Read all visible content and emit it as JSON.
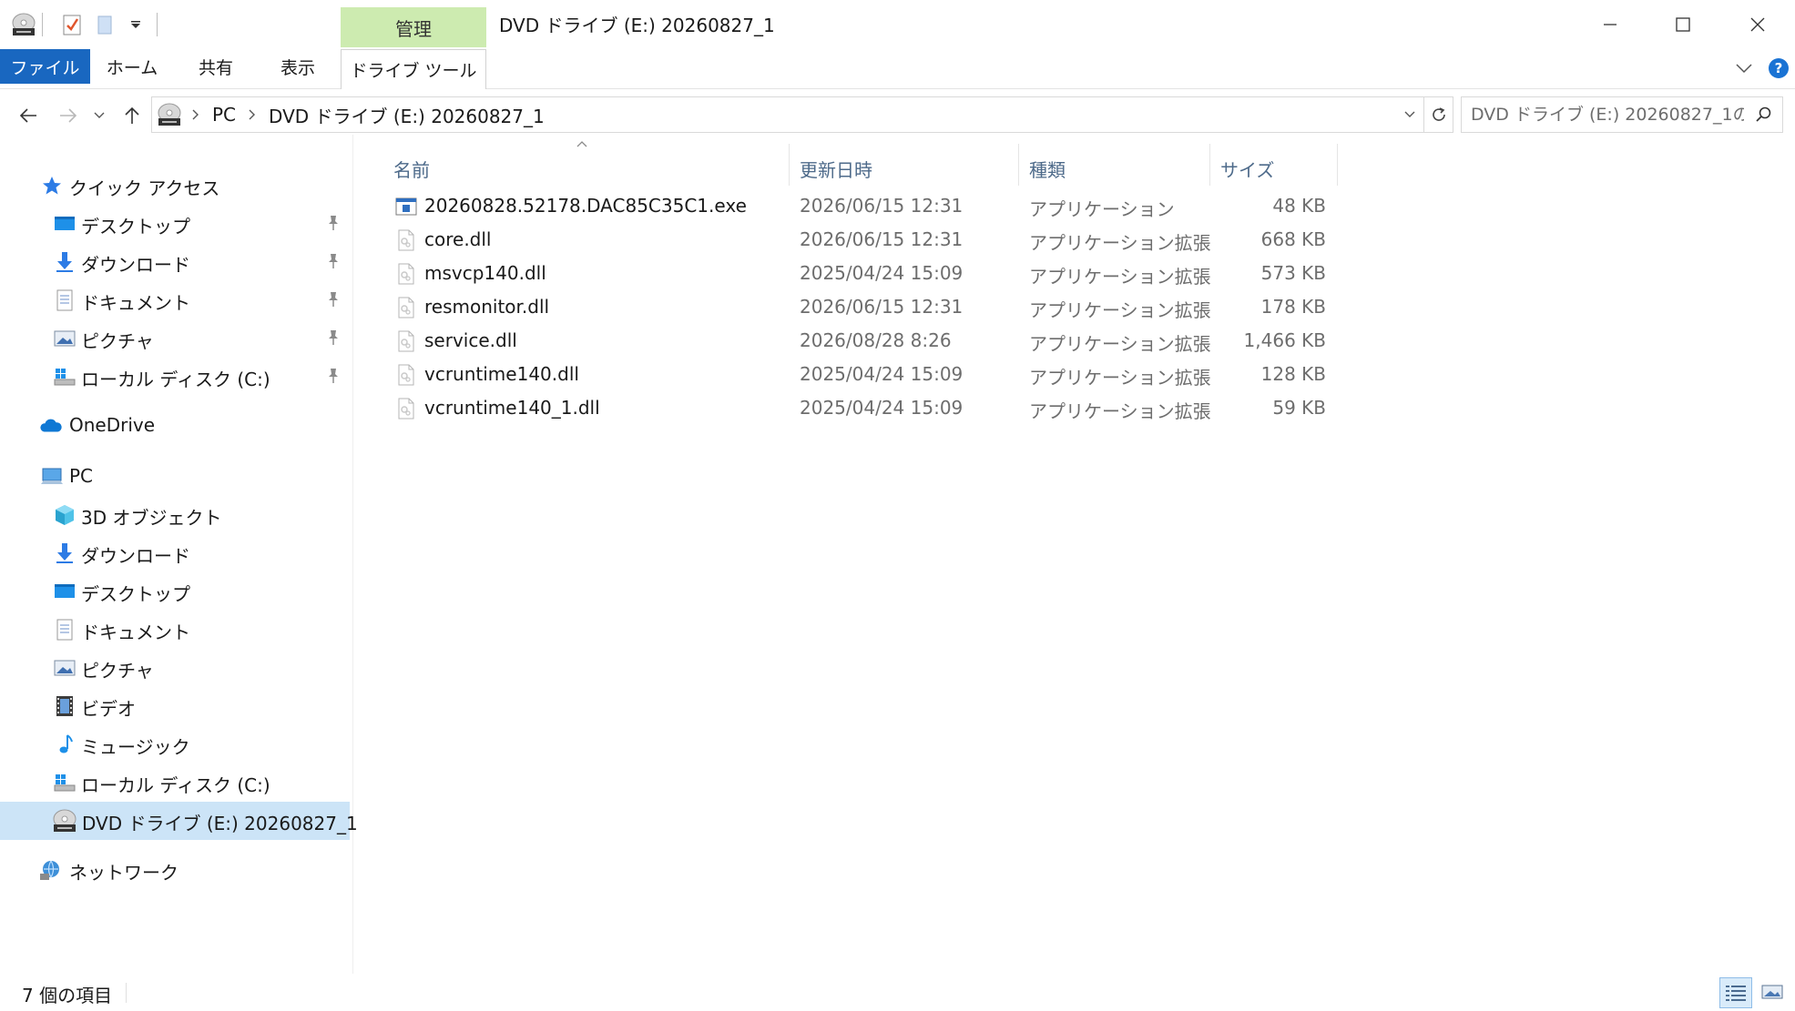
{
  "window": {
    "title": "DVD ドライブ (E:) 20260827_1",
    "contextual_tab_group": "管理"
  },
  "ribbon": {
    "tabs": [
      "ファイル",
      "ホーム",
      "共有",
      "表示",
      "ドライブ ツール"
    ]
  },
  "address_bar": {
    "crumbs": [
      "PC",
      "DVD ドライブ (E:) 20260827_1"
    ]
  },
  "search": {
    "placeholder": "DVD ドライブ (E:) 20260827_1の..."
  },
  "nav": {
    "quick_access": "クイック アクセス",
    "quick_items": [
      "デスクトップ",
      "ダウンロード",
      "ドキュメント",
      "ピクチャ",
      "ローカル ディスク (C:)"
    ],
    "onedrive": "OneDrive",
    "pc": "PC",
    "pc_items": [
      "3D オブジェクト",
      "ダウンロード",
      "デスクトップ",
      "ドキュメント",
      "ピクチャ",
      "ビデオ",
      "ミュージック",
      "ローカル ディスク (C:)",
      "DVD ドライブ (E:) 20260827_1"
    ],
    "network": "ネットワーク"
  },
  "columns": {
    "name": "名前",
    "date": "更新日時",
    "type": "種類",
    "size": "サイズ"
  },
  "files": [
    {
      "name": "20260828.52178.DAC85C35C1.exe",
      "date": "2026/06/15 12:31",
      "type": "アプリケーション",
      "size": "48 KB",
      "icon": "exe-icon"
    },
    {
      "name": "core.dll",
      "date": "2026/06/15 12:31",
      "type": "アプリケーション拡張",
      "size": "668 KB",
      "icon": "dll-icon"
    },
    {
      "name": "msvcp140.dll",
      "date": "2025/04/24 15:09",
      "type": "アプリケーション拡張",
      "size": "573 KB",
      "icon": "dll-icon"
    },
    {
      "name": "resmonitor.dll",
      "date": "2026/06/15 12:31",
      "type": "アプリケーション拡張",
      "size": "178 KB",
      "icon": "dll-icon"
    },
    {
      "name": "service.dll",
      "date": "2026/08/28 8:26",
      "type": "アプリケーション拡張",
      "size": "1,466 KB",
      "icon": "dll-icon"
    },
    {
      "name": "vcruntime140.dll",
      "date": "2025/04/24 15:09",
      "type": "アプリケーション拡張",
      "size": "128 KB",
      "icon": "dll-icon"
    },
    {
      "name": "vcruntime140_1.dll",
      "date": "2025/04/24 15:09",
      "type": "アプリケーション拡張",
      "size": "59 KB",
      "icon": "dll-icon"
    }
  ],
  "status": {
    "item_count": "7 個の項目"
  },
  "colors": {
    "file_tab": "#1967c0",
    "manage_tab": "#cdebb0",
    "selection": "#cce4f7",
    "header_text": "#4d6a8a"
  }
}
